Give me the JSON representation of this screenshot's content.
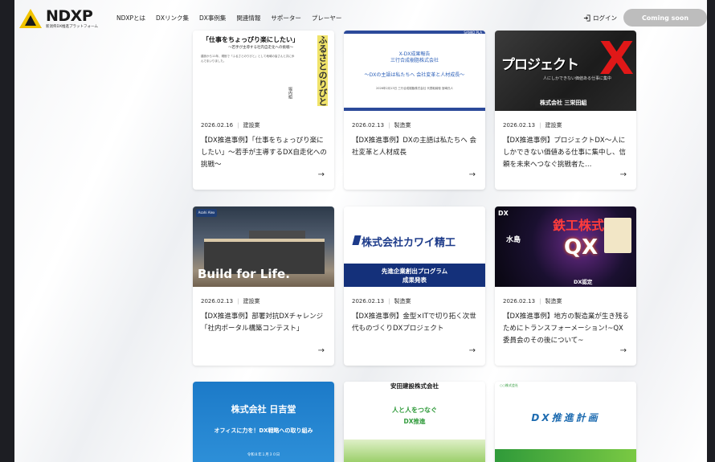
{
  "header": {
    "logo_text": "NDXP",
    "logo_sub": "新潟県DX推進プラットフォーム",
    "nav": [
      "NDXPとは",
      "DXリンク集",
      "DX事例集",
      "関連情報",
      "サポーター",
      "プレーヤー"
    ],
    "login_label": "ログイン",
    "coming_soon_label": "Coming soon"
  },
  "cards": [
    {
      "date": "2026.02.16",
      "category": "建設業",
      "title": "【DX推進事例】「仕事をちょっぴり楽にしたい」～若手が主導するDX自走化への挑戦～",
      "thumb": {
        "headline": "「仕事をちょっぴり楽にしたい」",
        "subheadline": "～若手が主導する社内自走化への挑戦～",
        "body": "建設から11年、現役で「ふるさとのりびと」として地域の皆さんと共に歩んでまいりました。",
        "vertical": "ふるさとのりびと",
        "author": "堀内組"
      }
    },
    {
      "date": "2026.02.13",
      "category": "製造業",
      "title": "【DX推進事例】DXの主語は私たちへ 会社変革と人材成長",
      "thumb": {
        "brand": "SANKO PLA",
        "line1": "X-DX成果報告",
        "line2": "三行合成樹脂株式会社",
        "line3": "～DXの主語は私たちへ 会社変革と人材成長～",
        "line4": "2026年2月13日 三行合成樹脂株式会社 代表取締役 宮崎氏人"
      }
    },
    {
      "date": "2026.02.13",
      "category": "建設業",
      "title": "【DX推進事例】プロジェクトDX～人にしかできない価値ある仕事に集中し、信頼を未来へつなぐ挑戦者た…",
      "thumb": {
        "title": "プロジェクト",
        "big": "X",
        "sub": "人にしかできない価値ある仕事に集中",
        "company": "株式会社 三栄田組"
      }
    },
    {
      "date": "2026.02.13",
      "category": "建設業",
      "title": "【DX推進事例】部署対抗DXチャレンジ「社内ポータル構築コンテスト」",
      "thumb": {
        "badge": "Asahi Alex",
        "caption": "Build for Life."
      }
    },
    {
      "date": "2026.02.13",
      "category": "製造業",
      "title": "【DX推進事例】金型×ITで切り拓く次世代ものづくりDXプロジェクト",
      "thumb": {
        "company": "株式会社カワイ精工",
        "line1": "先進企業創出プログラム",
        "line2": "成果発表"
      }
    },
    {
      "date": "2026.02.13",
      "category": "製造業",
      "title": "【DX推進事例】地方の製造業が生き残るためにトランスフォーメーション!~QX委員会のその後について~",
      "thumb": {
        "corner": "DX",
        "city": "水島",
        "big": "鉄工株式会社",
        "q": "QX",
        "dx": "DX認定"
      }
    },
    {
      "date": "",
      "category": "",
      "title": "",
      "thumb": {
        "company": "株式会社 日吉堂",
        "sub": "オフィスに力を！DX戦略への取り組み",
        "date": "令和８年１月３０日"
      }
    },
    {
      "date": "",
      "category": "",
      "title": "",
      "thumb": {
        "logo": "安田建設株式会社",
        "g1": "人と人をつなぐ",
        "g2": "DX推進"
      }
    },
    {
      "date": "",
      "category": "",
      "title": "",
      "thumb": {
        "top": "○○株式会社",
        "title": "DX推進計画"
      }
    }
  ]
}
